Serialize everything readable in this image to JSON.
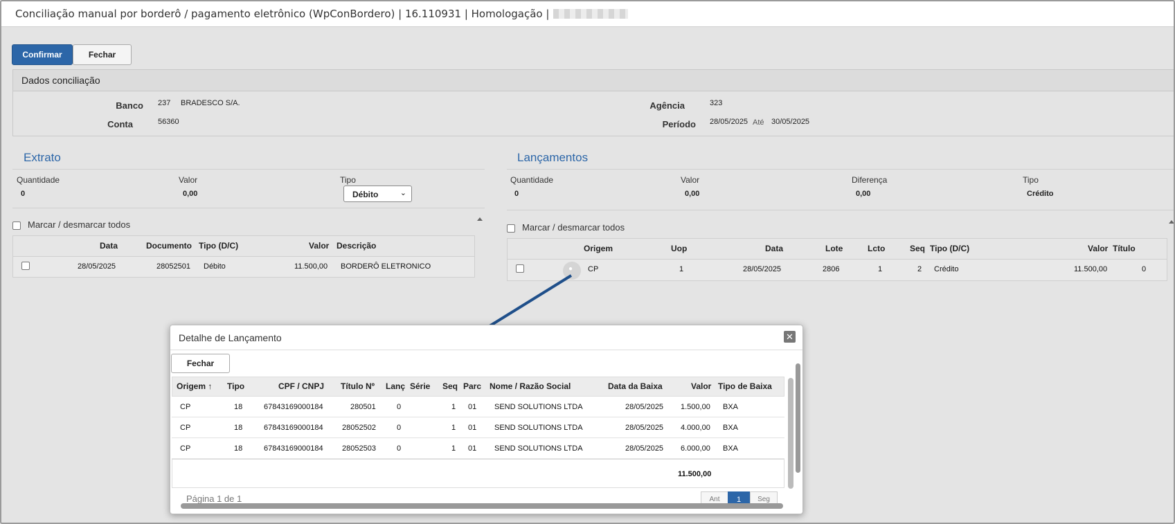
{
  "window": {
    "title": "Conciliação manual por borderô / pagamento eletrônico (WpConBordero) | 16.110931 | Homologação |"
  },
  "toolbar": {
    "confirm": "Confirmar",
    "close": "Fechar"
  },
  "dados": {
    "header": "Dados conciliação",
    "banco_label": "Banco",
    "banco_code": "237",
    "banco_name": "BRADESCO S/A.",
    "conta_label": "Conta",
    "conta": "56360",
    "agencia_label": "Agência",
    "agencia": "323",
    "periodo_label": "Período",
    "periodo_from": "28/05/2025",
    "ate": "Até",
    "periodo_to": "30/05/2025"
  },
  "extrato": {
    "title": "Extrato",
    "qtd_label": "Quantidade",
    "qtd": "0",
    "valor_label": "Valor",
    "valor": "0,00",
    "tipo_label": "Tipo",
    "tipo_selected": "Débito",
    "select_all": "Marcar / desmarcar todos",
    "columns": {
      "data": "Data",
      "documento": "Documento",
      "tipo": "Tipo (D/C)",
      "valor": "Valor",
      "descricao": "Descrição"
    },
    "rows": [
      {
        "data": "28/05/2025",
        "documento": "28052501",
        "tipo": "Débito",
        "valor": "11.500,00",
        "descricao": "BORDERÔ ELETRONICO"
      }
    ]
  },
  "lancamentos": {
    "title": "Lançamentos",
    "qtd_label": "Quantidade",
    "qtd": "0",
    "valor_label": "Valor",
    "valor": "0,00",
    "dif_label": "Diferença",
    "dif": "0,00",
    "tipo_label": "Tipo",
    "tipo": "Crédito",
    "select_all": "Marcar / desmarcar todos",
    "columns": {
      "origem": "Origem",
      "uop": "Uop",
      "data": "Data",
      "lote": "Lote",
      "lcto": "Lcto",
      "seq": "Seq",
      "tipo": "Tipo (D/C)",
      "valor": "Valor",
      "titulo": "Título"
    },
    "rows": [
      {
        "origem": "CP",
        "uop": "1",
        "data": "28/05/2025",
        "lote": "2806",
        "lcto": "1",
        "seq": "2",
        "tipo": "Crédito",
        "valor": "11.500,00",
        "titulo": "0"
      }
    ]
  },
  "modal": {
    "title": "Detalhe de Lançamento",
    "close_button": "Fechar",
    "columns": {
      "origem": "Origem",
      "tipo": "Tipo",
      "cpf": "CPF / CNPJ",
      "titulo": "Título Nº",
      "lanc": "Lanç",
      "serie": "Série",
      "seq": "Seq",
      "parc": "Parc",
      "nome": "Nome / Razão Social",
      "data": "Data da Baixa",
      "valor": "Valor",
      "tipo_baixa": "Tipo de Baixa"
    },
    "rows": [
      {
        "origem": "CP",
        "tipo": "18",
        "cpf": "67843169000184",
        "titulo": "280501",
        "lanc": "0",
        "seq": "1",
        "parc": "01",
        "nome": "SEND SOLUTIONS LTDA",
        "data": "28/05/2025",
        "valor": "1.500,00",
        "tipo_baixa": "BXA"
      },
      {
        "origem": "CP",
        "tipo": "18",
        "cpf": "67843169000184",
        "titulo": "28052502",
        "lanc": "0",
        "seq": "1",
        "parc": "01",
        "nome": "SEND SOLUTIONS LTDA",
        "data": "28/05/2025",
        "valor": "4.000,00",
        "tipo_baixa": "BXA"
      },
      {
        "origem": "CP",
        "tipo": "18",
        "cpf": "67843169000184",
        "titulo": "28052503",
        "lanc": "0",
        "seq": "1",
        "parc": "01",
        "nome": "SEND SOLUTIONS LTDA",
        "data": "28/05/2025",
        "valor": "6.000,00",
        "tipo_baixa": "BXA"
      }
    ],
    "total": "11.500,00",
    "pagination": "Página 1 de 1",
    "prev": "Ant",
    "page": "1",
    "next": "Seg"
  },
  "colors": {
    "accent": "#2c66a8",
    "arrow": "#1f4f8a"
  }
}
